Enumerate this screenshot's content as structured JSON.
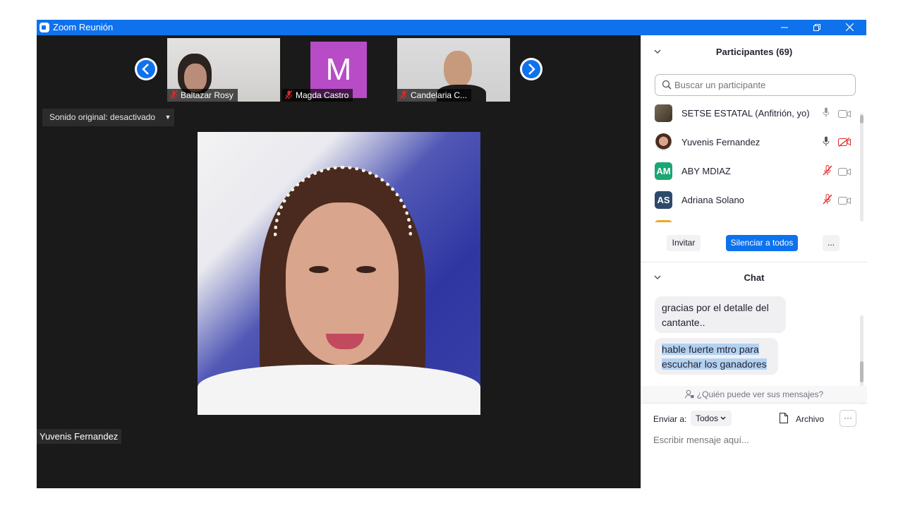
{
  "window": {
    "title": "Zoom Reunión",
    "min_icon": "minimize-icon",
    "max_icon": "restore-icon",
    "close_icon": "close-icon"
  },
  "gallery": {
    "thumbnails": [
      {
        "name": "Baltazar Rosy",
        "muted": true
      },
      {
        "name": "Magda Castro",
        "muted": true,
        "avatar_letter": "M",
        "avatar_color": "#b84cc7"
      },
      {
        "name": "Candelaria C...",
        "muted": true
      }
    ]
  },
  "audio": {
    "original_sound": "Sonido original: desactivado"
  },
  "main_video": {
    "speaker_name": "Yuvenis Fernandez"
  },
  "participants": {
    "header": "Participantes (69)",
    "search_placeholder": "Buscar un participante",
    "list": [
      {
        "name": "SETSE ESTATAL (Anfitrión, yo)",
        "avatar": "photo",
        "mic": "on",
        "video": "on"
      },
      {
        "name": "Yuvenis Fernandez",
        "avatar": "photo",
        "mic": "on",
        "video": "off"
      },
      {
        "name": "ABY MDIAZ",
        "initials": "AM",
        "avatar_color": "#1ba673",
        "mic": "muted",
        "video": "on"
      },
      {
        "name": "Adriana Solano",
        "initials": "AS",
        "avatar_color": "#2d4a6b",
        "mic": "muted",
        "video": "on"
      }
    ],
    "invite": "Invitar",
    "mute_all": "Silenciar a todos",
    "more": "..."
  },
  "chat": {
    "header": "Chat",
    "messages": [
      {
        "text": "gracias por el detalle del cantante.."
      },
      {
        "text": "hable fuerte mtro para escuchar los ganadores",
        "highlighted": true
      }
    ],
    "who_can_see": "¿Quién puede ver sus mensajes?",
    "send_to_label": "Enviar a:",
    "send_to_value": "Todos",
    "file": "Archivo",
    "more": "···",
    "input_placeholder": "Escribir mensaje aquí..."
  },
  "colors": {
    "accent": "#0e72ed",
    "muted_red": "#e02828"
  }
}
